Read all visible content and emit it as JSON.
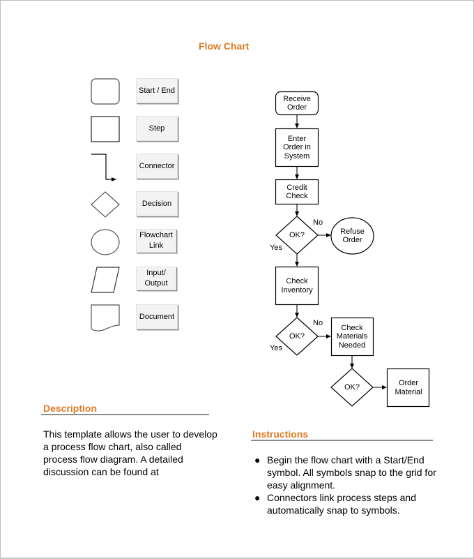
{
  "title": "Flow Chart",
  "legend": [
    {
      "shape": "start-end",
      "label": "Start / End"
    },
    {
      "shape": "step",
      "label": "Step"
    },
    {
      "shape": "connector",
      "label": "Connector"
    },
    {
      "shape": "decision",
      "label": "Decision"
    },
    {
      "shape": "flowchart-link",
      "label": "Flowchart Link"
    },
    {
      "shape": "input-output",
      "label": "Input/ Output"
    },
    {
      "shape": "document",
      "label": "Document"
    }
  ],
  "flowchart": {
    "nodes": {
      "receive_order": "Receive Order",
      "enter_order": "Enter Order in System",
      "credit_check": "Credit Check",
      "decision_1": "OK?",
      "refuse_order": "Refuse Order",
      "check_inventory": "Check Inventory",
      "decision_2": "OK?",
      "check_materials": "Check Materials Needed",
      "decision_3": "OK?",
      "order_material": "Order Material"
    },
    "edge_labels": {
      "d1_no": "No",
      "d1_yes": "Yes",
      "d2_no": "No",
      "d2_yes": "Yes"
    }
  },
  "description": {
    "heading": "Description",
    "text": "This template allows the user to develop a process flow chart, also called process flow diagram.  A detailed discussion can be found at"
  },
  "instructions": {
    "heading": "Instructions",
    "bullet": "●",
    "items": [
      "Begin the flow chart with a Start/End symbol.  All symbols snap to the grid for easy alignment.",
      "Connectors link process steps and automatically snap to symbols."
    ]
  },
  "colors": {
    "accent": "#e07a25",
    "rule": "#8c8c8c",
    "button_fill": "#f3f3f3"
  }
}
